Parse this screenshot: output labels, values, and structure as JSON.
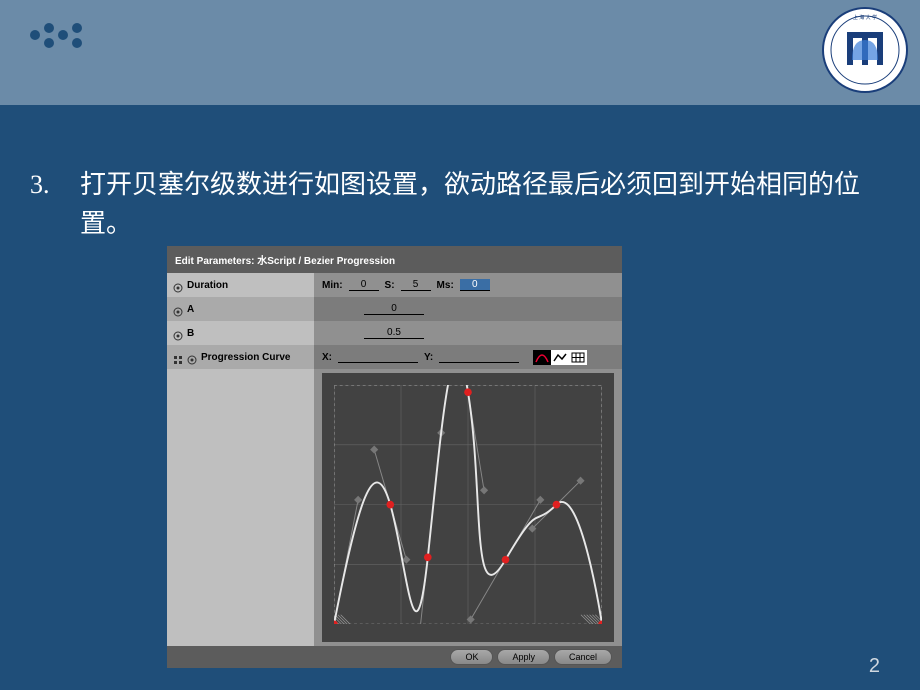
{
  "instruction": {
    "number": "3.",
    "text": "打开贝塞尔级数进行如图设置，欲动路径最后必须回到开始相同的位置。"
  },
  "dialog": {
    "title": "Edit Parameters: 水Script / Bezier Progression",
    "params": {
      "duration": {
        "label": "Duration",
        "min_label": "Min:",
        "min": "0",
        "s_label": "S:",
        "s": "5",
        "ms_label": "Ms:",
        "ms": "0"
      },
      "a": {
        "label": "A",
        "value": "0"
      },
      "b": {
        "label": "B",
        "value": "0.5"
      },
      "progression": {
        "label": "Progression Curve",
        "x_label": "X:",
        "x": "",
        "y_label": "Y:",
        "y": ""
      }
    },
    "buttons": {
      "ok": "OK",
      "apply": "Apply",
      "cancel": "Cancel"
    }
  },
  "page_number": "2",
  "chart_data": {
    "type": "line",
    "title": "",
    "xlabel": "",
    "ylabel": "",
    "xlim": [
      0,
      1
    ],
    "ylim": [
      0,
      1
    ],
    "points": [
      {
        "x": 0.0,
        "y": 0.0
      },
      {
        "x": 0.21,
        "y": 0.5
      },
      {
        "x": 0.35,
        "y": 0.28
      },
      {
        "x": 0.5,
        "y": 0.97
      },
      {
        "x": 0.64,
        "y": 0.27
      },
      {
        "x": 0.83,
        "y": 0.5
      },
      {
        "x": 1.0,
        "y": 0.0
      }
    ],
    "handles": [
      {
        "ax": 0.0,
        "ay": 0.0,
        "bx": 0.09,
        "by": 0.52
      },
      {
        "ax": 0.21,
        "ay": 0.5,
        "bx": 0.27,
        "by": 0.27
      },
      {
        "ax": 0.35,
        "ay": 0.28,
        "bx": 0.4,
        "by": 0.8
      },
      {
        "ax": 0.5,
        "ay": 0.97,
        "bx": 0.56,
        "by": 0.56
      },
      {
        "ax": 0.64,
        "ay": 0.27,
        "bx": 0.77,
        "by": 0.52
      },
      {
        "ax": 0.83,
        "ay": 0.5,
        "bx": 0.92,
        "by": 0.6
      },
      {
        "ax": 1.0,
        "ay": 0.0,
        "bx": 1.0,
        "by": 0.0
      }
    ]
  }
}
